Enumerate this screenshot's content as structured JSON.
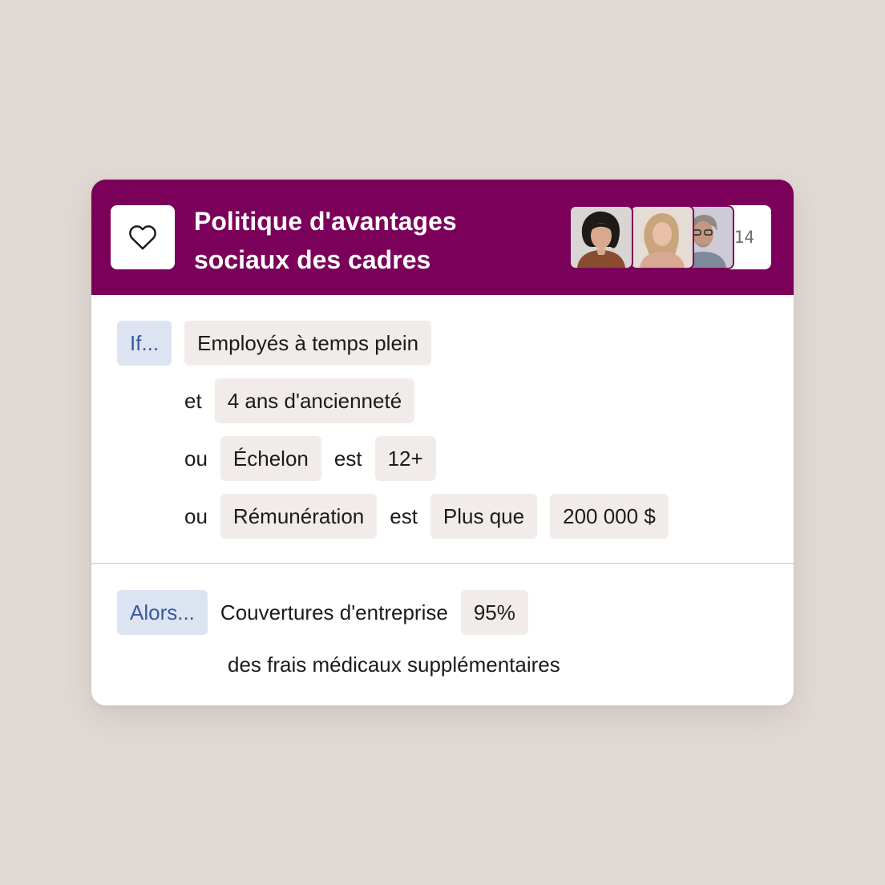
{
  "card": {
    "title_line1": "Politique d'avantages",
    "title_line2": "sociaux des cadres",
    "header_color": "#7a005a",
    "icon": "heart-icon",
    "members_extra": "+14"
  },
  "conditions": {
    "keyword": "If...",
    "rows": [
      {
        "chips": [
          "Employés à temps plein"
        ]
      },
      {
        "op": "et",
        "chips": [
          "4 ans d'ancienneté"
        ]
      },
      {
        "op": "ou",
        "field": "Échelon",
        "verb": "est",
        "value": "12+"
      },
      {
        "op": "ou",
        "field": "Rémunération",
        "verb": "est",
        "comparator": "Plus que",
        "value": "200 000 $"
      }
    ]
  },
  "result": {
    "keyword": "Alors...",
    "text": "Couvertures d'entreprise",
    "value": "95%",
    "tail": "des frais médicaux supplémentaires"
  }
}
